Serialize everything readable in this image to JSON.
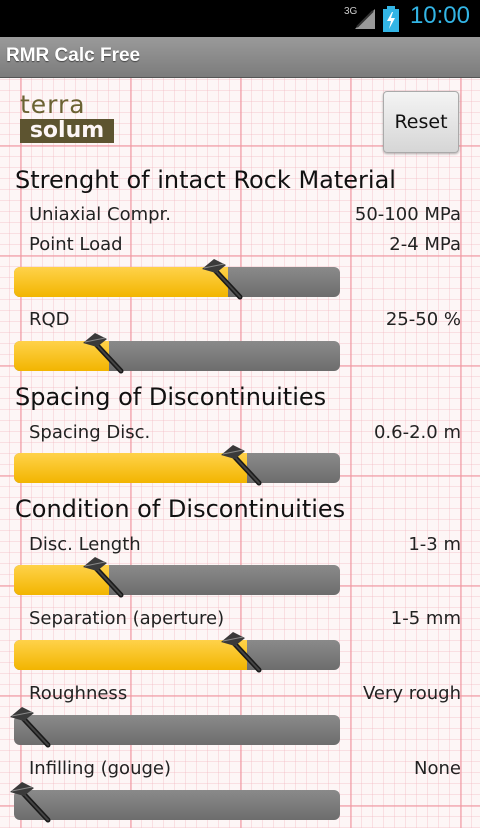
{
  "status_bar": {
    "network": "3G",
    "time": "10:00"
  },
  "title_bar": {
    "title": "RMR Calc Free"
  },
  "logo": {
    "top": "terra",
    "bottom": "solum"
  },
  "reset_label": "Reset",
  "colors": {
    "accent": "#33b5e5",
    "slider_fill": "#f2b500",
    "slider_track": "#7a7a7a"
  },
  "sections": [
    {
      "title": "Strenght of intact Rock Material",
      "rows": [
        {
          "label": "Uniaxial Compr.",
          "value": "50-100 MPa",
          "slider": false
        },
        {
          "label": "Point Load",
          "value": "2-4 MPa",
          "slider": true,
          "level": 0.68
        },
        {
          "label": "RQD",
          "value": "25-50 %",
          "slider": true,
          "level": 0.25
        }
      ]
    },
    {
      "title": "Spacing of Discontinuities",
      "rows": [
        {
          "label": "Spacing Disc.",
          "value": "0.6-2.0 m",
          "slider": true,
          "level": 0.75
        }
      ]
    },
    {
      "title": "Condition of Discontinuities",
      "rows": [
        {
          "label": "Disc. Length",
          "value": "1-3 m",
          "slider": true,
          "level": 0.25
        },
        {
          "label": "Separation (aperture)",
          "value": "1-5 mm",
          "slider": true,
          "level": 0.75
        },
        {
          "label": "Roughness",
          "value": "Very rough",
          "slider": true,
          "level": 0.0
        },
        {
          "label": "Infilling (gouge)",
          "value": "None",
          "slider": true,
          "level": 0.0
        }
      ]
    }
  ]
}
